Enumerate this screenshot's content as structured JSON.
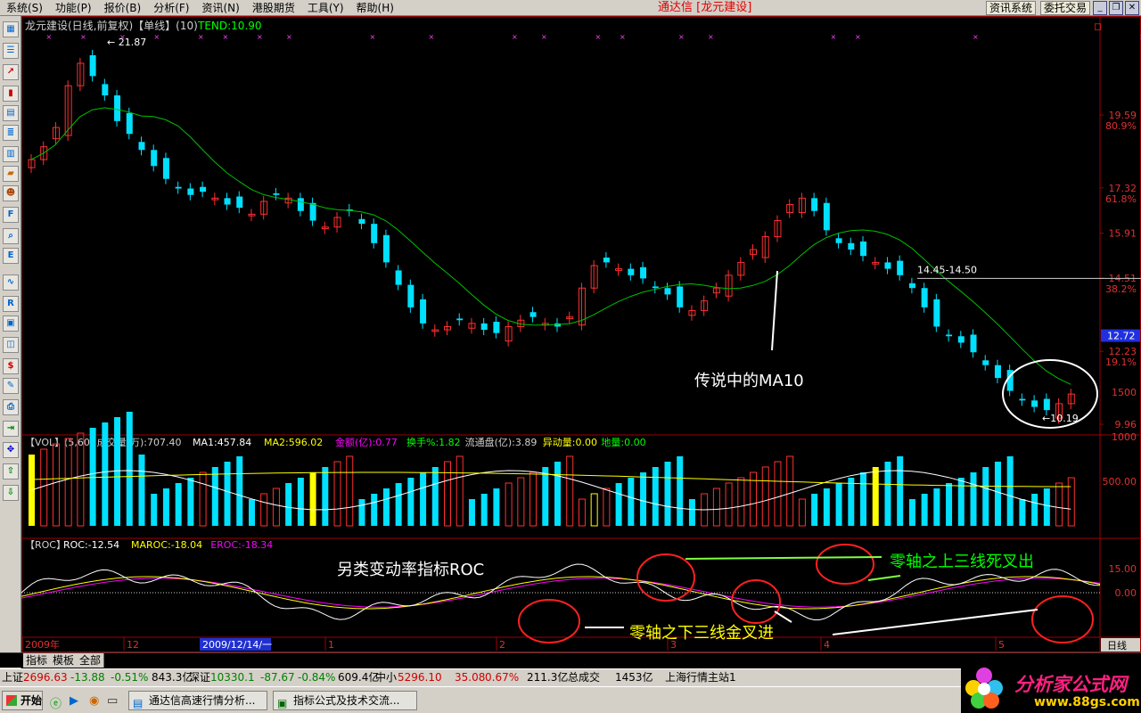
{
  "menu": {
    "items": [
      "系统(S)",
      "功能(P)",
      "报价(B)",
      "分析(F)",
      "资讯(N)",
      "港股期货",
      "工具(Y)",
      "帮助(H)"
    ],
    "app_title": "通达信 [龙元建设]",
    "btn_news": "资讯系统",
    "btn_trade": "委托交易"
  },
  "price_panel": {
    "header": {
      "name": "龙元建设(日线,前复权)",
      "mode": "【单线】",
      "period": "(10)",
      "tend": "TEND:10.90"
    },
    "y_ticks": [
      {
        "label": "19.59",
        "value": 19.59,
        "color": "#e03030"
      },
      {
        "label": "80.9%",
        "value": 19.59,
        "color": "#e03030",
        "sub": true
      },
      {
        "label": "17.32",
        "value": 17.32,
        "color": "#e03030"
      },
      {
        "label": "61.8%",
        "value": 17.32,
        "color": "#e03030",
        "sub": true
      },
      {
        "label": "15.91",
        "value": 15.91,
        "color": "#e03030"
      },
      {
        "label": "14.51",
        "value": 14.51,
        "color": "#e03030"
      },
      {
        "label": "38.2%",
        "value": 14.51,
        "color": "#e03030",
        "sub": true
      },
      {
        "label": "12.23",
        "value": 12.23,
        "color": "#e03030"
      },
      {
        "label": "19.1%",
        "value": 12.23,
        "color": "#e03030",
        "sub": true
      },
      {
        "label": "9.96",
        "value": 9.96,
        "color": "#e03030"
      }
    ],
    "current_price": "12.72",
    "high_marker": "21.87",
    "low_marker": "10.19",
    "level_label": "14.45-14.50",
    "annotation": "传说中的MA10"
  },
  "vol_panel": {
    "header": [
      {
        "text": "【VOL】(5,60) 成交量(万):707.40",
        "color": "#d0d0d0"
      },
      {
        "text": "MA1:457.84",
        "color": "#ffffff"
      },
      {
        "text": "MA2:596.02",
        "color": "#ffff00"
      },
      {
        "text": "金额(亿):0.77",
        "color": "#ff00ff"
      },
      {
        "text": "换手%:1.82",
        "color": "#00ff00"
      },
      {
        "text": "流通盘(亿):3.89",
        "color": "#d0d0d0"
      },
      {
        "text": "异动量:0.00",
        "color": "#ffff00"
      },
      {
        "text": "地量:0.00",
        "color": "#00ff00"
      }
    ],
    "y_ticks": [
      "1500",
      "1000",
      "500.00"
    ]
  },
  "roc_panel": {
    "header": [
      {
        "text": "【ROC】",
        "color": "#d0d0d0"
      },
      {
        "text": "ROC:-12.54",
        "color": "#ffffff"
      },
      {
        "text": "MAROC:-18.04",
        "color": "#ffff00"
      },
      {
        "text": "EROC:-18.34",
        "color": "#ff00ff"
      }
    ],
    "y_ticks": [
      "15.00",
      "0.00"
    ],
    "annotation_title": "另类变动率指标ROC",
    "annotation_death": "零轴之上三线死叉出",
    "annotation_golden": "零轴之下三线金叉进"
  },
  "x_axis": {
    "labels": [
      "2009年",
      "12",
      "2009/12/14/一",
      "1",
      "2",
      "3",
      "4",
      "5"
    ],
    "period": "日线"
  },
  "bottom_tabs": [
    "指标",
    "模板",
    "全部"
  ],
  "status": {
    "sh_name": "上证",
    "sh_index": "2696.63",
    "sh_chg": "-13.88",
    "sh_pct": "-0.51%",
    "sh_amt": "843.3亿",
    "sz_name": "深证",
    "sz_index": "10330.1",
    "sz_chg": "-87.67",
    "sz_pct": "-0.84%",
    "sz_amt": "609.4亿",
    "zx_name": "中小",
    "zx_index": "5296.10",
    "zx_chg": "35.08",
    "zx_pct": "0.67%",
    "zx_amt": "211.3亿",
    "total_label": "总成交",
    "total_amt": "1453亿",
    "server": "上海行情主站1"
  },
  "taskbar": {
    "start": "开始",
    "tasks": [
      "通达信高速行情分析...",
      "指标公式及技术交流..."
    ]
  },
  "logo": {
    "title": "分析家公式网",
    "url": "www.88gs.com"
  }
}
